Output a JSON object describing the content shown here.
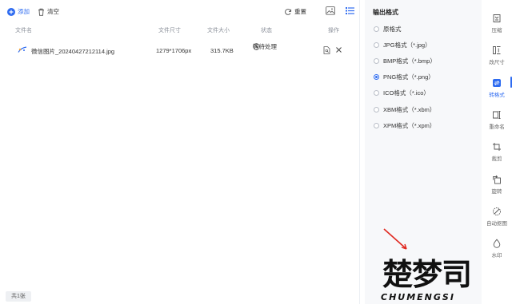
{
  "toolbar": {
    "add_label": "添加",
    "clear_label": "清空",
    "reset_label": "重置"
  },
  "table": {
    "columns": [
      "文件名",
      "文件尺寸",
      "文件大小",
      "状态",
      "操作"
    ],
    "rows": [
      {
        "file_name": "微信图片_20240427212114.jpg",
        "dimensions": "1279*1706px",
        "size": "315.7KB",
        "status": "等待处理"
      }
    ]
  },
  "footer": {
    "count_label": "共1张"
  },
  "settings": {
    "title": "输出格式",
    "options": [
      {
        "label": "原格式",
        "selected": false
      },
      {
        "label": "JPG格式（*.jpg）",
        "selected": false
      },
      {
        "label": "BMP格式（*.bmp）",
        "selected": false
      },
      {
        "label": "PNG格式（*.png）",
        "selected": true
      },
      {
        "label": "ICO格式（*.ico）",
        "selected": false
      },
      {
        "label": "XBM格式（*.xbm）",
        "selected": false
      },
      {
        "label": "XPM格式（*.xpm）",
        "selected": false
      }
    ]
  },
  "nav": {
    "items": [
      {
        "label": "压缩",
        "icon": "compress-icon",
        "active": false
      },
      {
        "label": "改尺寸",
        "icon": "resize-icon",
        "active": false
      },
      {
        "label": "转格式",
        "icon": "convert-icon",
        "active": true
      },
      {
        "label": "重命名",
        "icon": "rename-icon",
        "active": false
      },
      {
        "label": "裁剪",
        "icon": "crop-icon",
        "active": false
      },
      {
        "label": "旋转",
        "icon": "rotate-icon",
        "active": false
      },
      {
        "label": "自动抠图",
        "icon": "cutout-icon",
        "active": false
      },
      {
        "label": "水印",
        "icon": "watermark-icon",
        "active": false
      }
    ]
  },
  "watermark": {
    "cn": "楚梦司",
    "en": "CHUMENGSI"
  },
  "colors": {
    "accent": "#2e6bf0",
    "panel_bg": "#f7f8fa",
    "muted": "#8a8f99"
  }
}
